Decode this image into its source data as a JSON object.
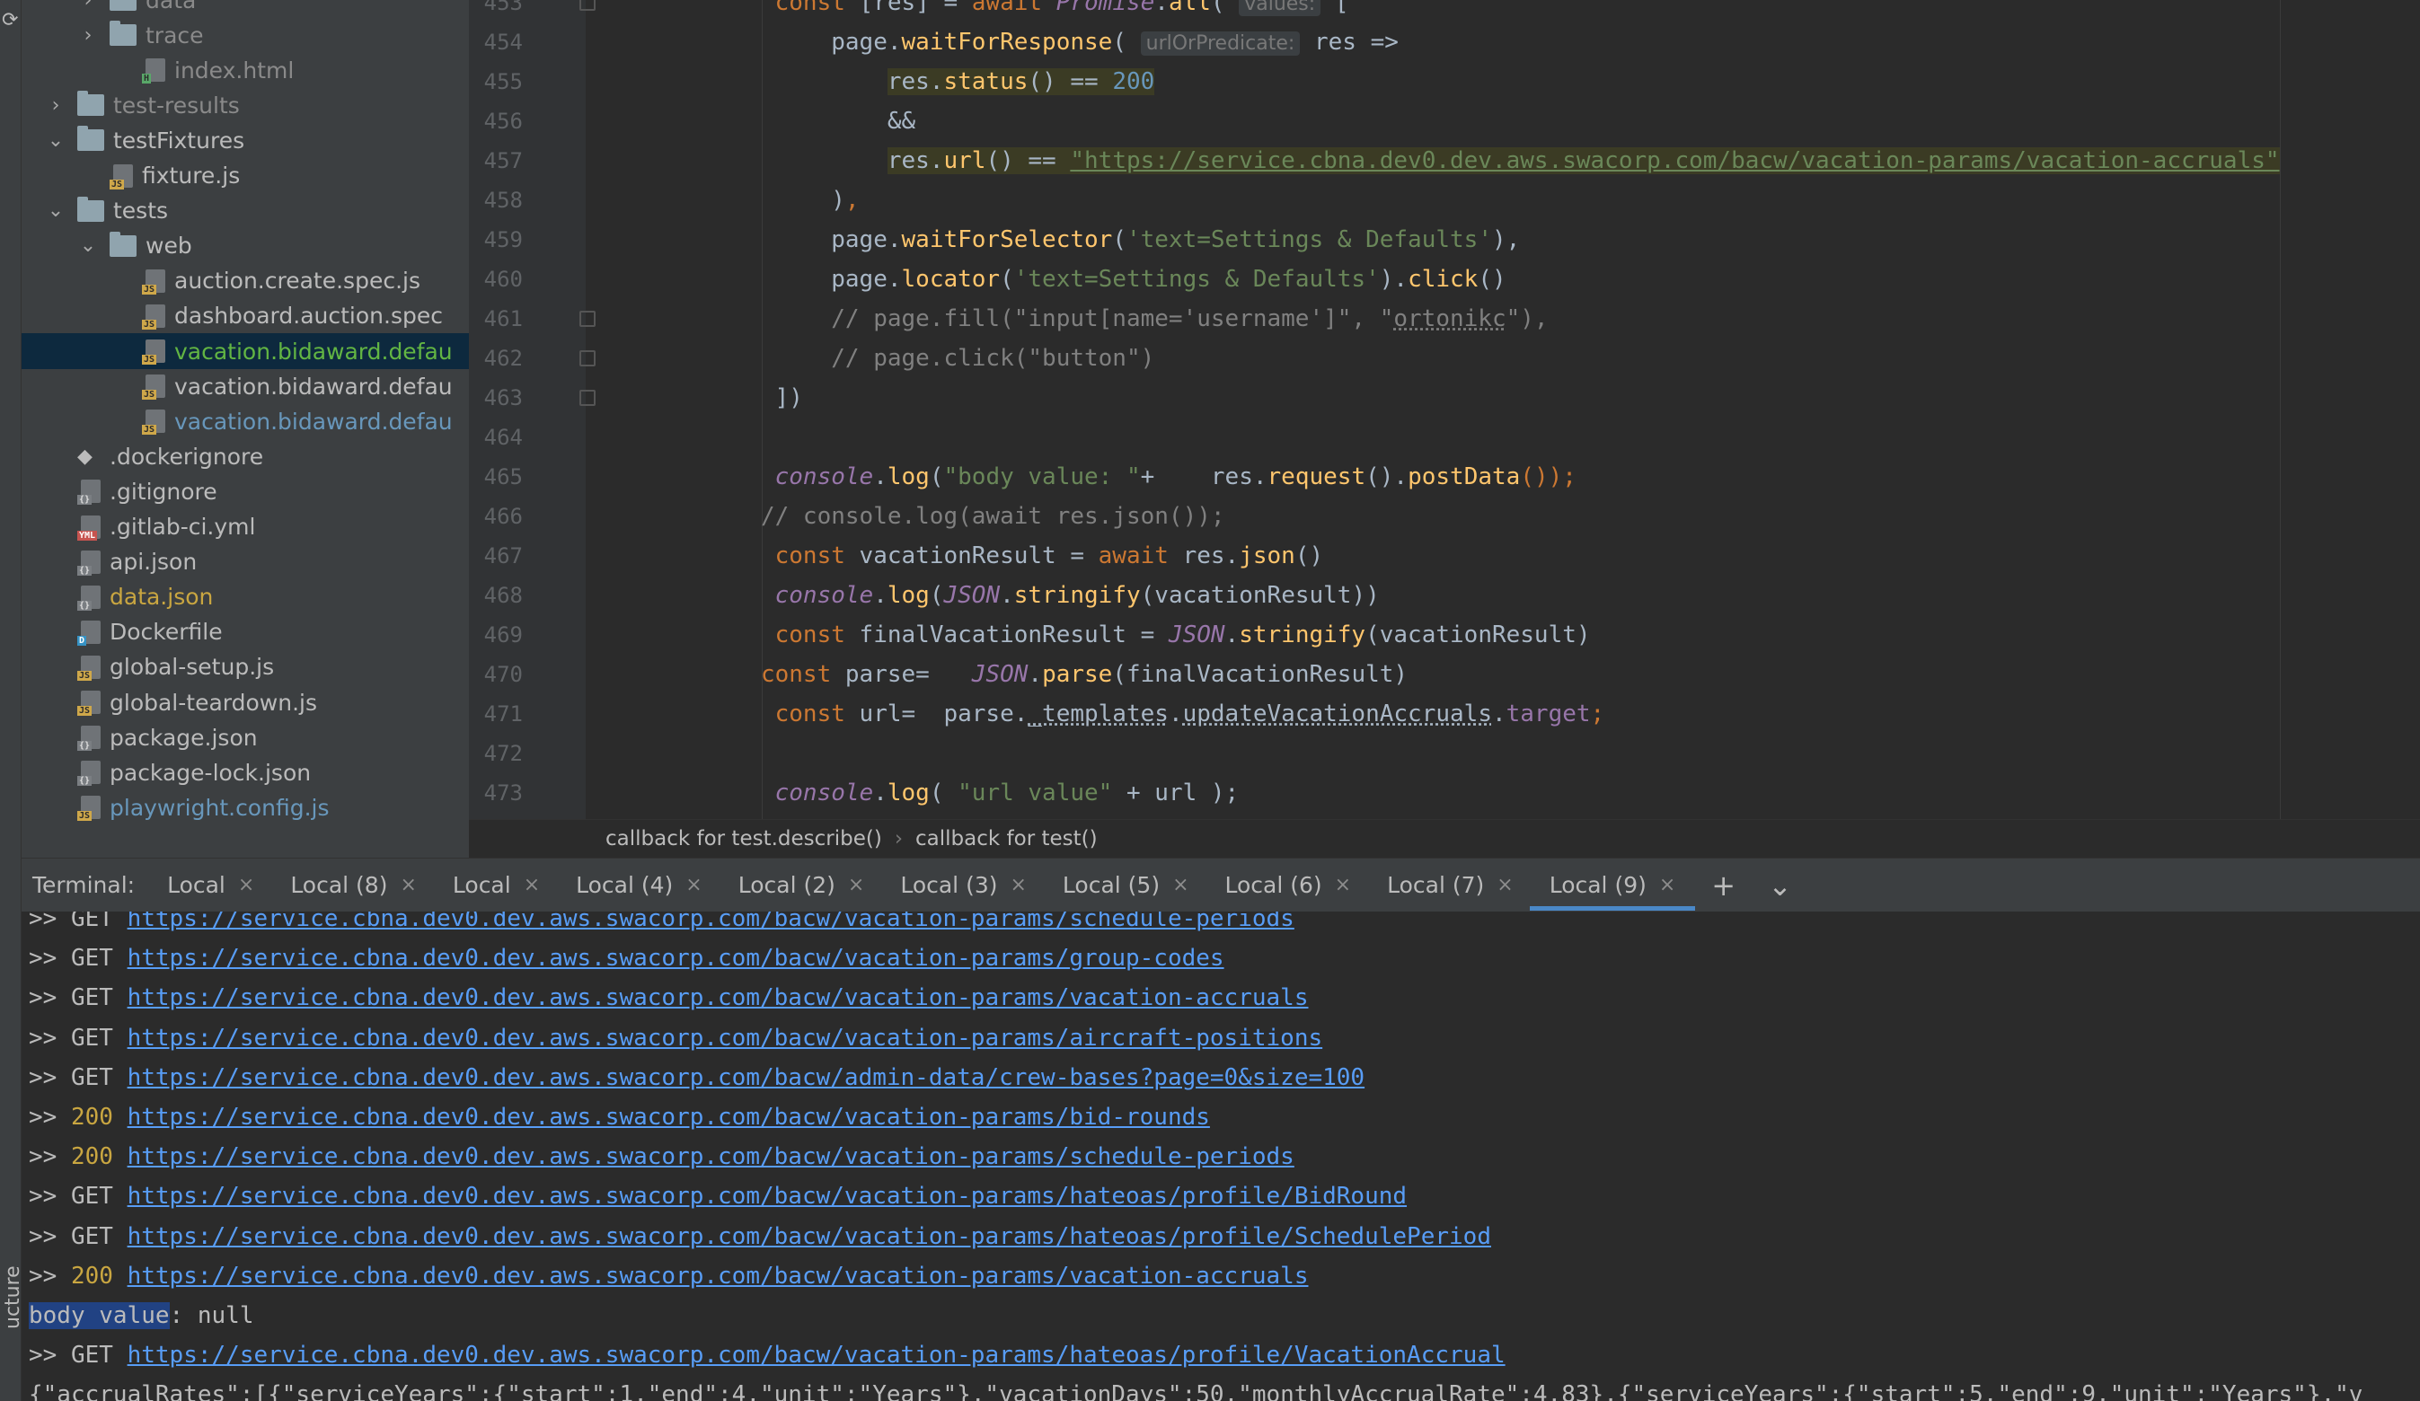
{
  "side_strip": {
    "label": "ucture"
  },
  "project_tree": [
    {
      "name": "data",
      "kind": "folder",
      "expanded": false,
      "indent": 2,
      "color": "grey"
    },
    {
      "name": "trace",
      "kind": "folder",
      "expanded": false,
      "indent": 2,
      "color": "grey"
    },
    {
      "name": "index.html",
      "kind": "file",
      "badge": "H",
      "indent": 3,
      "color": "grey"
    },
    {
      "name": "test-results",
      "kind": "folder",
      "expanded": false,
      "indent": 1,
      "color": "grey"
    },
    {
      "name": "testFixtures",
      "kind": "folder",
      "expanded": true,
      "indent": 1
    },
    {
      "name": "fixture.js",
      "kind": "file",
      "badge": "JS",
      "indent": 2
    },
    {
      "name": "tests",
      "kind": "folder",
      "expanded": true,
      "indent": 1
    },
    {
      "name": "web",
      "kind": "folder",
      "expanded": true,
      "indent": 2
    },
    {
      "name": "auction.create.spec.js",
      "kind": "file",
      "badge": "JS",
      "indent": 3
    },
    {
      "name": "dashboard.auction.spec",
      "kind": "file",
      "badge": "JS",
      "indent": 3
    },
    {
      "name": "vacation.bidaward.defau",
      "kind": "file",
      "badge": "JS",
      "indent": 3,
      "color": "green",
      "selected": true
    },
    {
      "name": "vacation.bidaward.defau",
      "kind": "file",
      "badge": "JS",
      "indent": 3
    },
    {
      "name": "vacation.bidaward.defau",
      "kind": "file",
      "badge": "JS",
      "indent": 3,
      "color": "blue"
    },
    {
      "name": ".dockerignore",
      "kind": "docker",
      "indent": 1
    },
    {
      "name": ".gitignore",
      "kind": "file",
      "badge": "{}",
      "indent": 1
    },
    {
      "name": ".gitlab-ci.yml",
      "kind": "file",
      "badge": "YML",
      "indent": 1
    },
    {
      "name": "api.json",
      "kind": "file",
      "badge": "{}",
      "indent": 1
    },
    {
      "name": "data.json",
      "kind": "file",
      "badge": "{}",
      "indent": 1,
      "color": "yellow"
    },
    {
      "name": "Dockerfile",
      "kind": "file",
      "badge": "D",
      "indent": 1
    },
    {
      "name": "global-setup.js",
      "kind": "file",
      "badge": "JS",
      "indent": 1
    },
    {
      "name": "global-teardown.js",
      "kind": "file",
      "badge": "JS",
      "indent": 1
    },
    {
      "name": "package.json",
      "kind": "file",
      "badge": "{}",
      "indent": 1
    },
    {
      "name": "package-lock.json",
      "kind": "file",
      "badge": "{}",
      "indent": 1
    },
    {
      "name": "playwright.config.js",
      "kind": "file",
      "badge": "JS",
      "indent": 1,
      "color": "blue"
    }
  ],
  "editor": {
    "line_numbers": [
      "453",
      "454",
      "455",
      "456",
      "457",
      "458",
      "459",
      "460",
      "461",
      "462",
      "463",
      "464",
      "465",
      "466",
      "467",
      "468",
      "469",
      "470",
      "471",
      "472",
      "473"
    ],
    "code": {
      "l453": {
        "indent": "    ",
        "a": "const ",
        "b": "[res] = ",
        "c": "await ",
        "d": "Promise",
        "e": ".",
        "f": "all",
        "g": "( ",
        "hint": "values:",
        "h": " ["
      },
      "l454": {
        "indent": "        ",
        "a": "page.",
        "b": "waitForResponse",
        "c": "( ",
        "hint": "urlOrPredicate:",
        "d": " res =>"
      },
      "l455": {
        "indent": "            ",
        "a": "res.",
        "b": "status",
        "c": "() == ",
        "d": "200"
      },
      "l456": {
        "indent": "            ",
        "a": "&&"
      },
      "l457": {
        "indent": "            ",
        "a": "res.",
        "b": "url",
        "c": "() == ",
        "d": "\"https://service.cbna.dev0.dev.aws.swacorp.com/bacw/vacation-params/vacation-accruals\""
      },
      "l458": {
        "indent": "        ",
        "a": ")",
        "b": ","
      },
      "l459": {
        "indent": "        ",
        "a": "page.",
        "b": "waitForSelector",
        "c": "(",
        "d": "'text=Settings & Defaults'",
        "e": "),"
      },
      "l460": {
        "indent": "        ",
        "a": "page.",
        "b": "locator",
        "c": "(",
        "d": "'text=Settings & Defaults'",
        "e": ").",
        "f": "click",
        "g": "()"
      },
      "l461": {
        "indent": "        ",
        "a": "// page.fill(\"input[name='username']\", \"",
        "b": "ortonikc",
        "c": "\"),"
      },
      "l462": {
        "indent": "        ",
        "a": "// page.click(\"button\")"
      },
      "l463": {
        "indent": "    ",
        "a": "])"
      },
      "l464": {
        "indent": "",
        "a": ""
      },
      "l465": {
        "indent": "    ",
        "a": "console",
        "b": ".",
        "c": "log",
        "d": "(",
        "e": "\"body value: \"",
        "f": "+    res.",
        "g": "request",
        "h": "().",
        "i": "postData",
        "j": "());"
      },
      "l466": {
        "indent": "   ",
        "a": "// console.log(await res.json());"
      },
      "l467": {
        "indent": "    ",
        "a": "const ",
        "b": "vacationResult = ",
        "c": "await ",
        "d": "res.",
        "e": "json",
        "f": "()"
      },
      "l468": {
        "indent": "    ",
        "a": "console",
        "b": ".",
        "c": "log",
        "d": "(",
        "e": "JSON",
        "f": ".",
        "g": "stringify",
        "h": "(vacationResult))"
      },
      "l469": {
        "indent": "    ",
        "a": "const ",
        "b": "finalVacationResult = ",
        "c": "JSON",
        "d": ".",
        "e": "stringify",
        "f": "(vacationResult)"
      },
      "l470": {
        "indent": "   ",
        "a": "const ",
        "b": "parse=   ",
        "c": "JSON",
        "d": ".",
        "e": "parse",
        "f": "(finalVacationResult)"
      },
      "l471": {
        "indent": "    ",
        "a": "const ",
        "b": "url=  parse.",
        "c": "_templates",
        "d": ".",
        "e": "updateVacationAccruals",
        "f": ".",
        "g": "target",
        "h": ";"
      },
      "l472": {
        "indent": "",
        "a": ""
      },
      "l473": {
        "indent": "    ",
        "a": "console",
        "b": ".",
        "c": "log",
        "d": "( ",
        "e": "\"url value\"",
        "f": " + url );"
      }
    }
  },
  "breadcrumb": {
    "items": [
      "callback for test.describe()",
      "callback for test()"
    ],
    "separator": "›"
  },
  "terminal": {
    "title": "Terminal:",
    "tabs": [
      {
        "label": "Local",
        "active": false
      },
      {
        "label": "Local (8)",
        "active": false
      },
      {
        "label": "Local",
        "active": false
      },
      {
        "label": "Local (4)",
        "active": false
      },
      {
        "label": "Local (2)",
        "active": false
      },
      {
        "label": "Local (3)",
        "active": false
      },
      {
        "label": "Local (5)",
        "active": false
      },
      {
        "label": "Local (6)",
        "active": false
      },
      {
        "label": "Local (7)",
        "active": false
      },
      {
        "label": "Local (9)",
        "active": true
      }
    ],
    "close_glyph": "×",
    "add_glyph": "+",
    "more_glyph": "⌄",
    "lines": [
      {
        "prefix": ">> ",
        "method": "GET",
        "url": "https://service.cbna.dev0.dev.aws.swacorp.com/bacw/vacation-params/schedule-periods"
      },
      {
        "prefix": ">> ",
        "method": "GET",
        "url": "https://service.cbna.dev0.dev.aws.swacorp.com/bacw/vacation-params/group-codes"
      },
      {
        "prefix": ">> ",
        "method": "GET",
        "url": "https://service.cbna.dev0.dev.aws.swacorp.com/bacw/vacation-params/vacation-accruals"
      },
      {
        "prefix": ">> ",
        "method": "GET",
        "url": "https://service.cbna.dev0.dev.aws.swacorp.com/bacw/vacation-params/aircraft-positions"
      },
      {
        "prefix": ">> ",
        "method": "GET",
        "url": "https://service.cbna.dev0.dev.aws.swacorp.com/bacw/admin-data/crew-bases?page=0&size=100"
      },
      {
        "prefix": ">> ",
        "method": "200",
        "url": "https://service.cbna.dev0.dev.aws.swacorp.com/bacw/vacation-params/bid-rounds"
      },
      {
        "prefix": ">> ",
        "method": "200",
        "url": "https://service.cbna.dev0.dev.aws.swacorp.com/bacw/vacation-params/schedule-periods"
      },
      {
        "prefix": ">> ",
        "method": "GET",
        "url": "https://service.cbna.dev0.dev.aws.swacorp.com/bacw/vacation-params/hateoas/profile/BidRound"
      },
      {
        "prefix": ">> ",
        "method": "GET",
        "url": "https://service.cbna.dev0.dev.aws.swacorp.com/bacw/vacation-params/hateoas/profile/SchedulePeriod"
      },
      {
        "prefix": ">> ",
        "method": "200",
        "url": "https://service.cbna.dev0.dev.aws.swacorp.com/bacw/vacation-params/vacation-accruals"
      }
    ],
    "body_value": {
      "selected": "body value",
      "rest": ": null"
    },
    "after_lines": [
      {
        "prefix": ">> ",
        "method": "GET",
        "url": "https://service.cbna.dev0.dev.aws.swacorp.com/bacw/vacation-params/hateoas/profile/VacationAccrual"
      }
    ],
    "json_line": "{\"accrualRates\":[{\"serviceYears\":{\"start\":1,\"end\":4,\"unit\":\"Years\"},\"vacationDays\":50,\"monthlyAccrualRate\":4.83},{\"serviceYears\":{\"start\":5,\"end\":9,\"unit\":\"Years\"},\"v"
  },
  "colors": {
    "panel_bg": "#3c3f41",
    "editor_bg": "#2b2b2b",
    "selection": "#0d293e",
    "link": "#589df6",
    "accent_tab": "#4a88c7"
  }
}
